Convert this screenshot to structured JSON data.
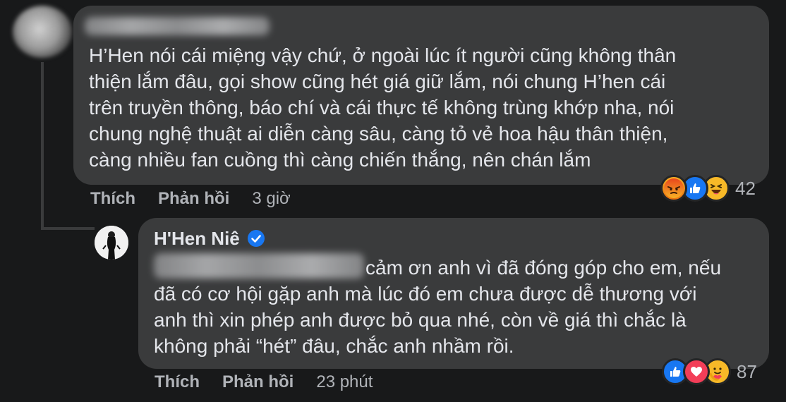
{
  "comment": {
    "text": "H’Hen nói cái miệng vậy chứ, ở ngoài lúc ít người cũng không thân\nthiện lắm đâu, gọi show cũng hét giá giữ lắm, nói chung H’hen cái\ntrên truyền thông, báo chí và cái thực tế không trùng khớp nha, nói\nchung nghệ thuật ai diễn càng sâu, càng tỏ vẻ hoa hậu thân thiện,\ncàng nhiều fan cuồng thì càng chiến thắng, nên chán lắm",
    "like_label": "Thích",
    "reply_label": "Phản hồi",
    "time": "3 giờ",
    "reaction_count": "42",
    "reactions": [
      "angry-icon",
      "like-icon",
      "haha-icon"
    ]
  },
  "reply": {
    "author": "H'Hen Niê",
    "text": "cảm ơn anh vì đã đóng góp cho em, nếu\nđã có cơ hội gặp anh mà lúc đó em chưa được dễ thương với\nanh thì xin phép anh được bỏ qua nhé, còn về giá thì chắc là\nkhông phải “hét” đâu, chắc anh nhầm rồi.",
    "like_label": "Thích",
    "reply_label": "Phản hồi",
    "time": "23 phút",
    "reaction_count": "87",
    "reactions": [
      "like-icon",
      "love-icon",
      "care-icon"
    ]
  },
  "colors": {
    "background": "#18191a",
    "bubble": "#3a3b3c",
    "text": "#e4e6eb",
    "secondary_text": "#b0b3b8",
    "verified": "#1877f2"
  }
}
